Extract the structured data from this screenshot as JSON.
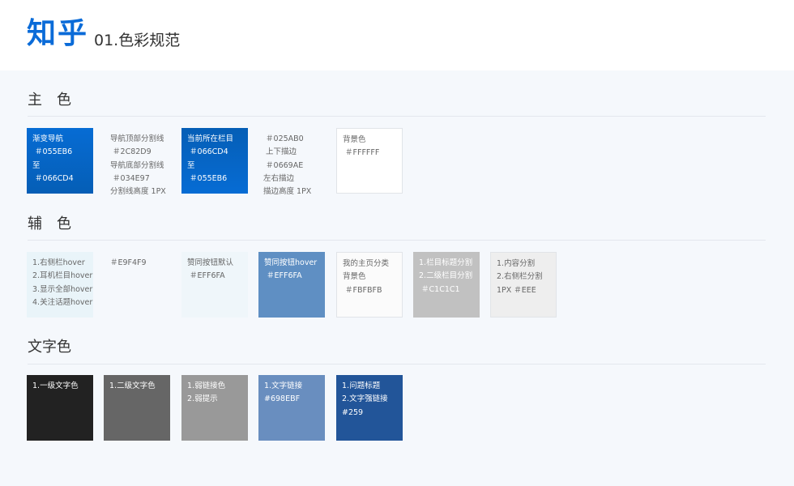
{
  "header": {
    "logo": "知乎",
    "subtitle": "01.色彩规范"
  },
  "sections": {
    "primary": {
      "title": "主　色",
      "swatches": [
        {
          "text": "渐变导航\n ＃055EB6\n至\n ＃066CD4"
        },
        {
          "text": "当前所在栏目\n ＃066CD4\n至\n ＃055EB6"
        },
        {
          "text": "背景色\n ＃FFFFFF"
        }
      ],
      "notes": [
        {
          "text": "导航顶部分割线\n ＃2C82D9\n导航底部分割线\n ＃034E97\n分割线高度 1PX"
        },
        {
          "text": " ＃025AB0\n 上下描边\n ＃0669AE\n左右描边\n描边高度 1PX"
        }
      ]
    },
    "secondary": {
      "title": "辅　色",
      "swatches": [
        {
          "text": "1.右侧栏hover\n2.耳机栏目hover\n3.显示全部hover\n4.关注话题hover"
        },
        {
          "text": "赞同按钮默认\n ＃EFF6FA"
        },
        {
          "text": "赞同按钮hover\n ＃EFF6FA"
        },
        {
          "text": "我的主页分类\n背景色\n ＃FBFBFB"
        },
        {
          "text": "1.栏目标题分割\n2.二级栏目分割\n ＃C1C1C1"
        },
        {
          "text": "1.内容分割\n2.右侧栏分割\n1PX ＃EEE"
        }
      ],
      "notes": [
        {
          "text": "＃E9F4F9"
        }
      ]
    },
    "text": {
      "title": "文字色",
      "swatches": [
        {
          "text": "1.一级文字色"
        },
        {
          "text": "1.二级文字色"
        },
        {
          "text": "1.弱链接色\n2.弱提示"
        },
        {
          "text": "1.文字链接\n#698EBF"
        },
        {
          "text": "1.问题标题\n2.文字强链接\n#259"
        }
      ]
    }
  },
  "colors": {
    "brand": "#0A6BD8",
    "gradient_nav": [
      "#055EB6",
      "#066CD4"
    ],
    "gradient_current": [
      "#066CD4",
      "#055EB6"
    ],
    "white": "#FFFFFF",
    "hover_bg": "#E9F4F9",
    "vote_default": "#EFF6FA",
    "vote_hover": "#5F8FC3",
    "profile_bg": "#FBFBFB",
    "divider_gray": "#C1C1C1",
    "content_divider": "#EEEEEE",
    "text_primary": "#222222",
    "text_secondary": "#666666",
    "text_weak": "#999999",
    "text_link": "#698EBF",
    "text_strong_link": "#225599"
  }
}
